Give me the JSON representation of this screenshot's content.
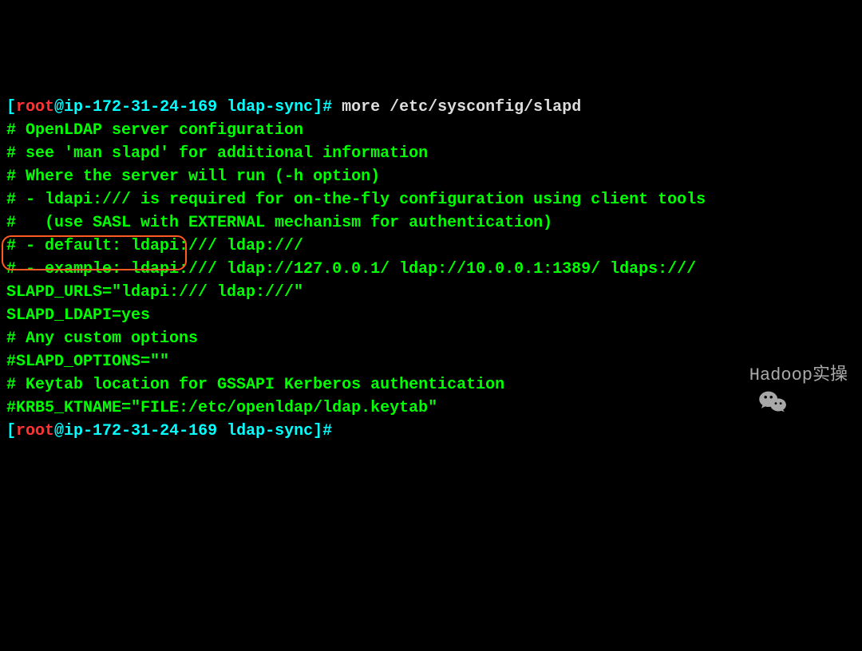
{
  "prompt1": {
    "open": "[",
    "user": "root",
    "at": "@",
    "host": "ip-172-31-24-169 ",
    "path": "ldap-sync",
    "close": "]#",
    "command": " more /etc/sysconfig/slapd"
  },
  "lines": {
    "l1": "# OpenLDAP server configuration",
    "l2": "# see 'man slapd' for additional information",
    "l3": "",
    "l4": "# Where the server will run (-h option)",
    "l5": "# - ldapi:/// is required for on-the-fly configuration using client tools",
    "l6": "#   (use SASL with EXTERNAL mechanism for authentication)",
    "l7": "# - default: ldapi:/// ldap:///",
    "l8": "# - example: ldapi:/// ldap://127.0.0.1/ ldap://10.0.0.1:1389/ ldaps:///",
    "l9": "SLAPD_URLS=\"ldapi:/// ldap:///\"",
    "l10": "SLAPD_LDAPI=yes",
    "l11": "# Any custom options",
    "l12": "#SLAPD_OPTIONS=\"\"",
    "l13": "",
    "l14": "# Keytab location for GSSAPI Kerberos authentication",
    "l15": "#KRB5_KTNAME=\"FILE:/etc/openldap/ldap.keytab\""
  },
  "prompt2": {
    "open": "[",
    "user": "root",
    "at": "@",
    "host": "ip-172-31-24-169 ",
    "path": "ldap-sync",
    "close": "]#"
  },
  "watermark": "Hadoop实操"
}
